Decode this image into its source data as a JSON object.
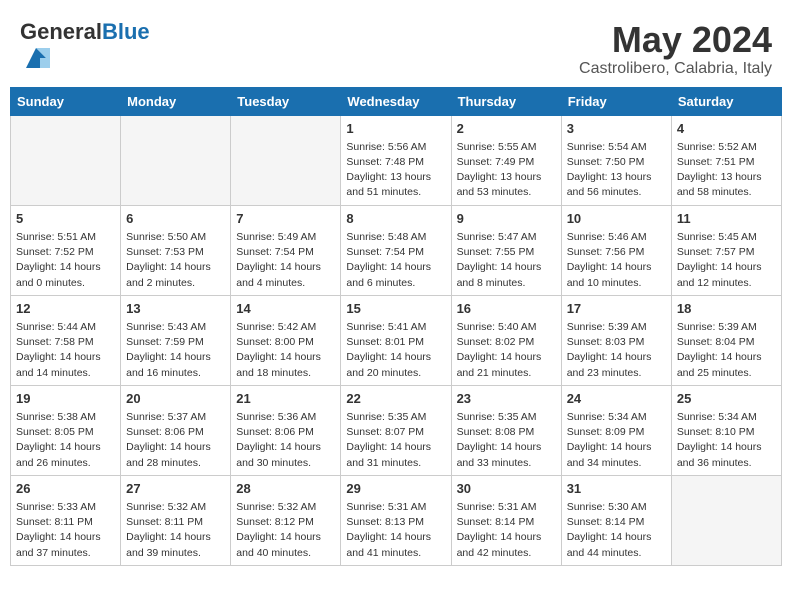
{
  "header": {
    "logo_general": "General",
    "logo_blue": "Blue",
    "month": "May 2024",
    "location": "Castrolibero, Calabria, Italy"
  },
  "days_of_week": [
    "Sunday",
    "Monday",
    "Tuesday",
    "Wednesday",
    "Thursday",
    "Friday",
    "Saturday"
  ],
  "weeks": [
    [
      {
        "day": "",
        "info": ""
      },
      {
        "day": "",
        "info": ""
      },
      {
        "day": "",
        "info": ""
      },
      {
        "day": "1",
        "info": "Sunrise: 5:56 AM\nSunset: 7:48 PM\nDaylight: 13 hours\nand 51 minutes."
      },
      {
        "day": "2",
        "info": "Sunrise: 5:55 AM\nSunset: 7:49 PM\nDaylight: 13 hours\nand 53 minutes."
      },
      {
        "day": "3",
        "info": "Sunrise: 5:54 AM\nSunset: 7:50 PM\nDaylight: 13 hours\nand 56 minutes."
      },
      {
        "day": "4",
        "info": "Sunrise: 5:52 AM\nSunset: 7:51 PM\nDaylight: 13 hours\nand 58 minutes."
      }
    ],
    [
      {
        "day": "5",
        "info": "Sunrise: 5:51 AM\nSunset: 7:52 PM\nDaylight: 14 hours\nand 0 minutes."
      },
      {
        "day": "6",
        "info": "Sunrise: 5:50 AM\nSunset: 7:53 PM\nDaylight: 14 hours\nand 2 minutes."
      },
      {
        "day": "7",
        "info": "Sunrise: 5:49 AM\nSunset: 7:54 PM\nDaylight: 14 hours\nand 4 minutes."
      },
      {
        "day": "8",
        "info": "Sunrise: 5:48 AM\nSunset: 7:54 PM\nDaylight: 14 hours\nand 6 minutes."
      },
      {
        "day": "9",
        "info": "Sunrise: 5:47 AM\nSunset: 7:55 PM\nDaylight: 14 hours\nand 8 minutes."
      },
      {
        "day": "10",
        "info": "Sunrise: 5:46 AM\nSunset: 7:56 PM\nDaylight: 14 hours\nand 10 minutes."
      },
      {
        "day": "11",
        "info": "Sunrise: 5:45 AM\nSunset: 7:57 PM\nDaylight: 14 hours\nand 12 minutes."
      }
    ],
    [
      {
        "day": "12",
        "info": "Sunrise: 5:44 AM\nSunset: 7:58 PM\nDaylight: 14 hours\nand 14 minutes."
      },
      {
        "day": "13",
        "info": "Sunrise: 5:43 AM\nSunset: 7:59 PM\nDaylight: 14 hours\nand 16 minutes."
      },
      {
        "day": "14",
        "info": "Sunrise: 5:42 AM\nSunset: 8:00 PM\nDaylight: 14 hours\nand 18 minutes."
      },
      {
        "day": "15",
        "info": "Sunrise: 5:41 AM\nSunset: 8:01 PM\nDaylight: 14 hours\nand 20 minutes."
      },
      {
        "day": "16",
        "info": "Sunrise: 5:40 AM\nSunset: 8:02 PM\nDaylight: 14 hours\nand 21 minutes."
      },
      {
        "day": "17",
        "info": "Sunrise: 5:39 AM\nSunset: 8:03 PM\nDaylight: 14 hours\nand 23 minutes."
      },
      {
        "day": "18",
        "info": "Sunrise: 5:39 AM\nSunset: 8:04 PM\nDaylight: 14 hours\nand 25 minutes."
      }
    ],
    [
      {
        "day": "19",
        "info": "Sunrise: 5:38 AM\nSunset: 8:05 PM\nDaylight: 14 hours\nand 26 minutes."
      },
      {
        "day": "20",
        "info": "Sunrise: 5:37 AM\nSunset: 8:06 PM\nDaylight: 14 hours\nand 28 minutes."
      },
      {
        "day": "21",
        "info": "Sunrise: 5:36 AM\nSunset: 8:06 PM\nDaylight: 14 hours\nand 30 minutes."
      },
      {
        "day": "22",
        "info": "Sunrise: 5:35 AM\nSunset: 8:07 PM\nDaylight: 14 hours\nand 31 minutes."
      },
      {
        "day": "23",
        "info": "Sunrise: 5:35 AM\nSunset: 8:08 PM\nDaylight: 14 hours\nand 33 minutes."
      },
      {
        "day": "24",
        "info": "Sunrise: 5:34 AM\nSunset: 8:09 PM\nDaylight: 14 hours\nand 34 minutes."
      },
      {
        "day": "25",
        "info": "Sunrise: 5:34 AM\nSunset: 8:10 PM\nDaylight: 14 hours\nand 36 minutes."
      }
    ],
    [
      {
        "day": "26",
        "info": "Sunrise: 5:33 AM\nSunset: 8:11 PM\nDaylight: 14 hours\nand 37 minutes."
      },
      {
        "day": "27",
        "info": "Sunrise: 5:32 AM\nSunset: 8:11 PM\nDaylight: 14 hours\nand 39 minutes."
      },
      {
        "day": "28",
        "info": "Sunrise: 5:32 AM\nSunset: 8:12 PM\nDaylight: 14 hours\nand 40 minutes."
      },
      {
        "day": "29",
        "info": "Sunrise: 5:31 AM\nSunset: 8:13 PM\nDaylight: 14 hours\nand 41 minutes."
      },
      {
        "day": "30",
        "info": "Sunrise: 5:31 AM\nSunset: 8:14 PM\nDaylight: 14 hours\nand 42 minutes."
      },
      {
        "day": "31",
        "info": "Sunrise: 5:30 AM\nSunset: 8:14 PM\nDaylight: 14 hours\nand 44 minutes."
      },
      {
        "day": "",
        "info": ""
      }
    ]
  ]
}
